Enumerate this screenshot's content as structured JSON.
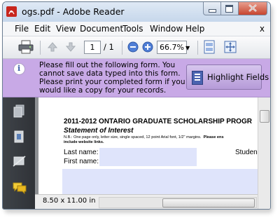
{
  "window": {
    "title": "ogs.pdf - Adobe Reader"
  },
  "menu": [
    "File",
    "Edit",
    "View",
    "Document",
    "Tools",
    "Window",
    "Help"
  ],
  "menu_close": "x",
  "toolbar": {
    "page_current": "1",
    "page_total": "/ 1",
    "zoom": "66.7%",
    "icons": [
      "printer-icon",
      "previous-page-icon",
      "next-page-icon",
      "zoom-out-icon",
      "zoom-in-icon",
      "scrolling-mode-icon",
      "fit-window-icon"
    ]
  },
  "form_bar": {
    "message_lines": [
      "Please fill out the following form. You",
      "cannot save data typed into this form.",
      "Please print your completed form if you",
      "would like a copy for your records."
    ],
    "highlight_button": "Highlight Fields",
    "background": "#c8a9e6"
  },
  "nav_pane": {
    "icons": [
      "pages-icon",
      "attachments-icon",
      "signatures-icon",
      "comments-icon"
    ]
  },
  "document": {
    "title": "2011-2012 ONTARIO GRADUATE SCHOLARSHIP PROGR",
    "subtitle": "Statement of Interest",
    "note_part1": "N.B.: One page only, letter size, single spaced, 12 point Arial font, 1/2\" margins.",
    "note_part2": "Please ens",
    "note_line2": "include website links.",
    "fields": [
      {
        "label": "Last name:"
      },
      {
        "label": "First name:"
      }
    ],
    "student_label": "Studen",
    "field_color": "#dfe4fb"
  },
  "status": {
    "page_size": "8.50 x 11.00 in"
  }
}
